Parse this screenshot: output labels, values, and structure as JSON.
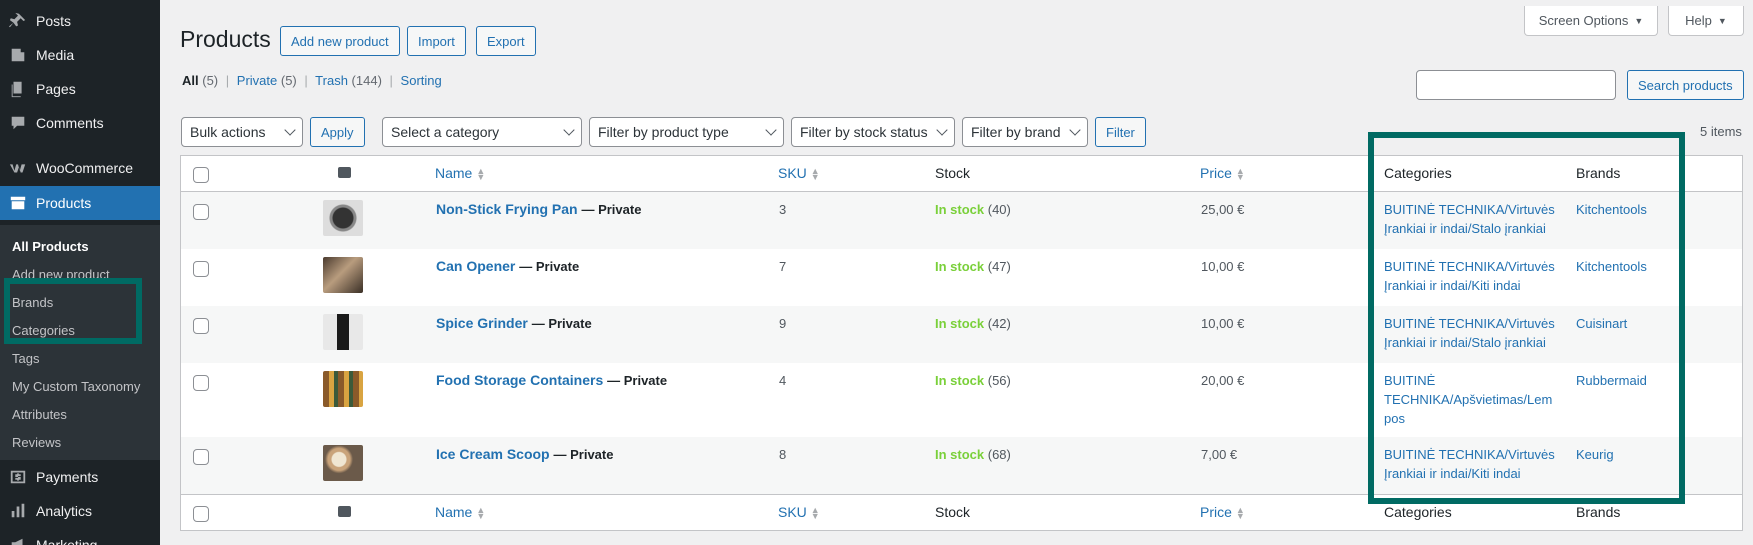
{
  "sidebar": {
    "menu": [
      {
        "label": "Posts",
        "icon": "pin-icon"
      },
      {
        "label": "Media",
        "icon": "media-icon"
      },
      {
        "label": "Pages",
        "icon": "pages-icon"
      },
      {
        "label": "Comments",
        "icon": "comments-icon"
      },
      {
        "label": "WooCommerce",
        "icon": "woocommerce-icon"
      },
      {
        "label": "Products",
        "icon": "products-icon"
      },
      {
        "label": "Payments",
        "icon": "payments-icon"
      },
      {
        "label": "Analytics",
        "icon": "analytics-icon"
      },
      {
        "label": "Marketing",
        "icon": "marketing-icon"
      }
    ],
    "submenu": [
      "All Products",
      "Add new product",
      "Brands",
      "Categories",
      "Tags",
      "My Custom Taxonomy",
      "Attributes",
      "Reviews"
    ]
  },
  "top": {
    "screen_options": "Screen Options",
    "help": "Help"
  },
  "header": {
    "title": "Products",
    "add_new": "Add new product",
    "import": "Import",
    "export": "Export"
  },
  "views": {
    "all": "All",
    "all_count": "(5)",
    "private": "Private",
    "private_count": "(5)",
    "trash": "Trash",
    "trash_count": "(144)",
    "sorting": "Sorting"
  },
  "search": {
    "button": "Search products",
    "value": ""
  },
  "filters": {
    "bulk": "Bulk actions",
    "apply": "Apply",
    "category": "Select a category",
    "type": "Filter by product type",
    "stock": "Filter by stock status",
    "brand": "Filter by brand",
    "filter": "Filter",
    "items": "5 items"
  },
  "table": {
    "columns": {
      "name": "Name",
      "sku": "SKU",
      "stock": "Stock",
      "price": "Price",
      "categories": "Categories",
      "brands": "Brands"
    },
    "rows": [
      {
        "name": "Non-Stick Frying Pan",
        "status": "— Private",
        "sku": "3",
        "stock": "In stock",
        "qty": "(40)",
        "price": "25,00 €",
        "cat1": "BUITINĖ TECHNIKA/Virtuvės",
        "cat2": "Įrankiai ir indai/Stalo įrankiai",
        "cat3": "",
        "brand": "Kitchentools"
      },
      {
        "name": "Can Opener",
        "status": "— Private",
        "sku": "7",
        "stock": "In stock",
        "qty": "(47)",
        "price": "10,00 €",
        "cat1": "BUITINĖ TECHNIKA/Virtuvės",
        "cat2": "Įrankiai ir indai/Kiti indai",
        "cat3": "",
        "brand": "Kitchentools"
      },
      {
        "name": "Spice Grinder",
        "status": "— Private",
        "sku": "9",
        "stock": "In stock",
        "qty": "(42)",
        "price": "10,00 €",
        "cat1": "BUITINĖ TECHNIKA/Virtuvės",
        "cat2": "Įrankiai ir indai/Stalo įrankiai",
        "cat3": "",
        "brand": "Cuisinart"
      },
      {
        "name": "Food Storage Containers",
        "status": "— Private",
        "sku": "4",
        "stock": "In stock",
        "qty": "(56)",
        "price": "20,00 €",
        "cat1": "BUITINĖ",
        "cat2": "TECHNIKA/Apšvietimas/Lem",
        "cat3": "pos",
        "brand": "Rubbermaid"
      },
      {
        "name": "Ice Cream Scoop",
        "status": "— Private",
        "sku": "8",
        "stock": "In stock",
        "qty": "(68)",
        "price": "7,00 €",
        "cat1": "BUITINĖ TECHNIKA/Virtuvės",
        "cat2": "Įrankiai ir indai/Kiti indai",
        "cat3": "",
        "brand": "Keurig"
      }
    ]
  },
  "colors": {
    "sidebar": "#1d2327",
    "active": "#2271b1",
    "link": "#2271b1",
    "instock": "#7ad03a",
    "annotation": "#006a63"
  }
}
